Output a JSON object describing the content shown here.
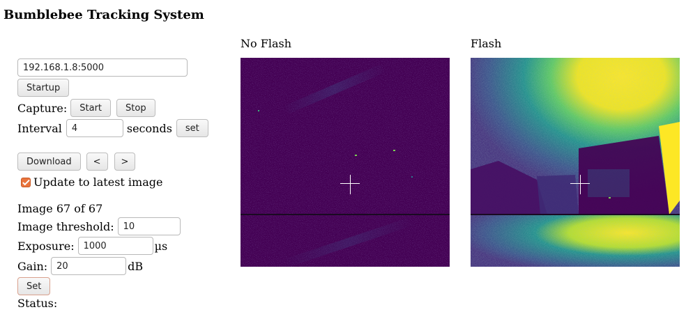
{
  "app": {
    "title": "Bumblebee Tracking System"
  },
  "controls": {
    "address_value": "192.168.1.8:5000",
    "startup_label": "Startup",
    "capture_label": "Capture:",
    "start_label": "Start",
    "stop_label": "Stop",
    "interval_label": "Interval",
    "interval_value": "4",
    "interval_unit": "seconds",
    "interval_set_label": "set",
    "download_label": "Download",
    "prev_label": "<",
    "next_label": ">",
    "update_latest_label": "Update to latest image",
    "update_latest_checked": true,
    "image_counter": "Image 67 of 67",
    "threshold_label": "Image threshold:",
    "threshold_value": "10",
    "exposure_label": "Exposure:",
    "exposure_value": "1000",
    "exposure_unit": "µs",
    "gain_label": "Gain:",
    "gain_value": "20",
    "gain_unit": "dB",
    "set_label": "Set",
    "status_label": "Status:"
  },
  "panels": {
    "no_flash_title": "No Flash",
    "flash_title": "Flash"
  },
  "colors": {
    "viridis_dark": "#440154",
    "viridis_blue": "#31688e",
    "viridis_teal": "#21918c",
    "viridis_green": "#35b779",
    "viridis_yellow": "#fde725",
    "checkbox_accent": "#e9743d"
  }
}
